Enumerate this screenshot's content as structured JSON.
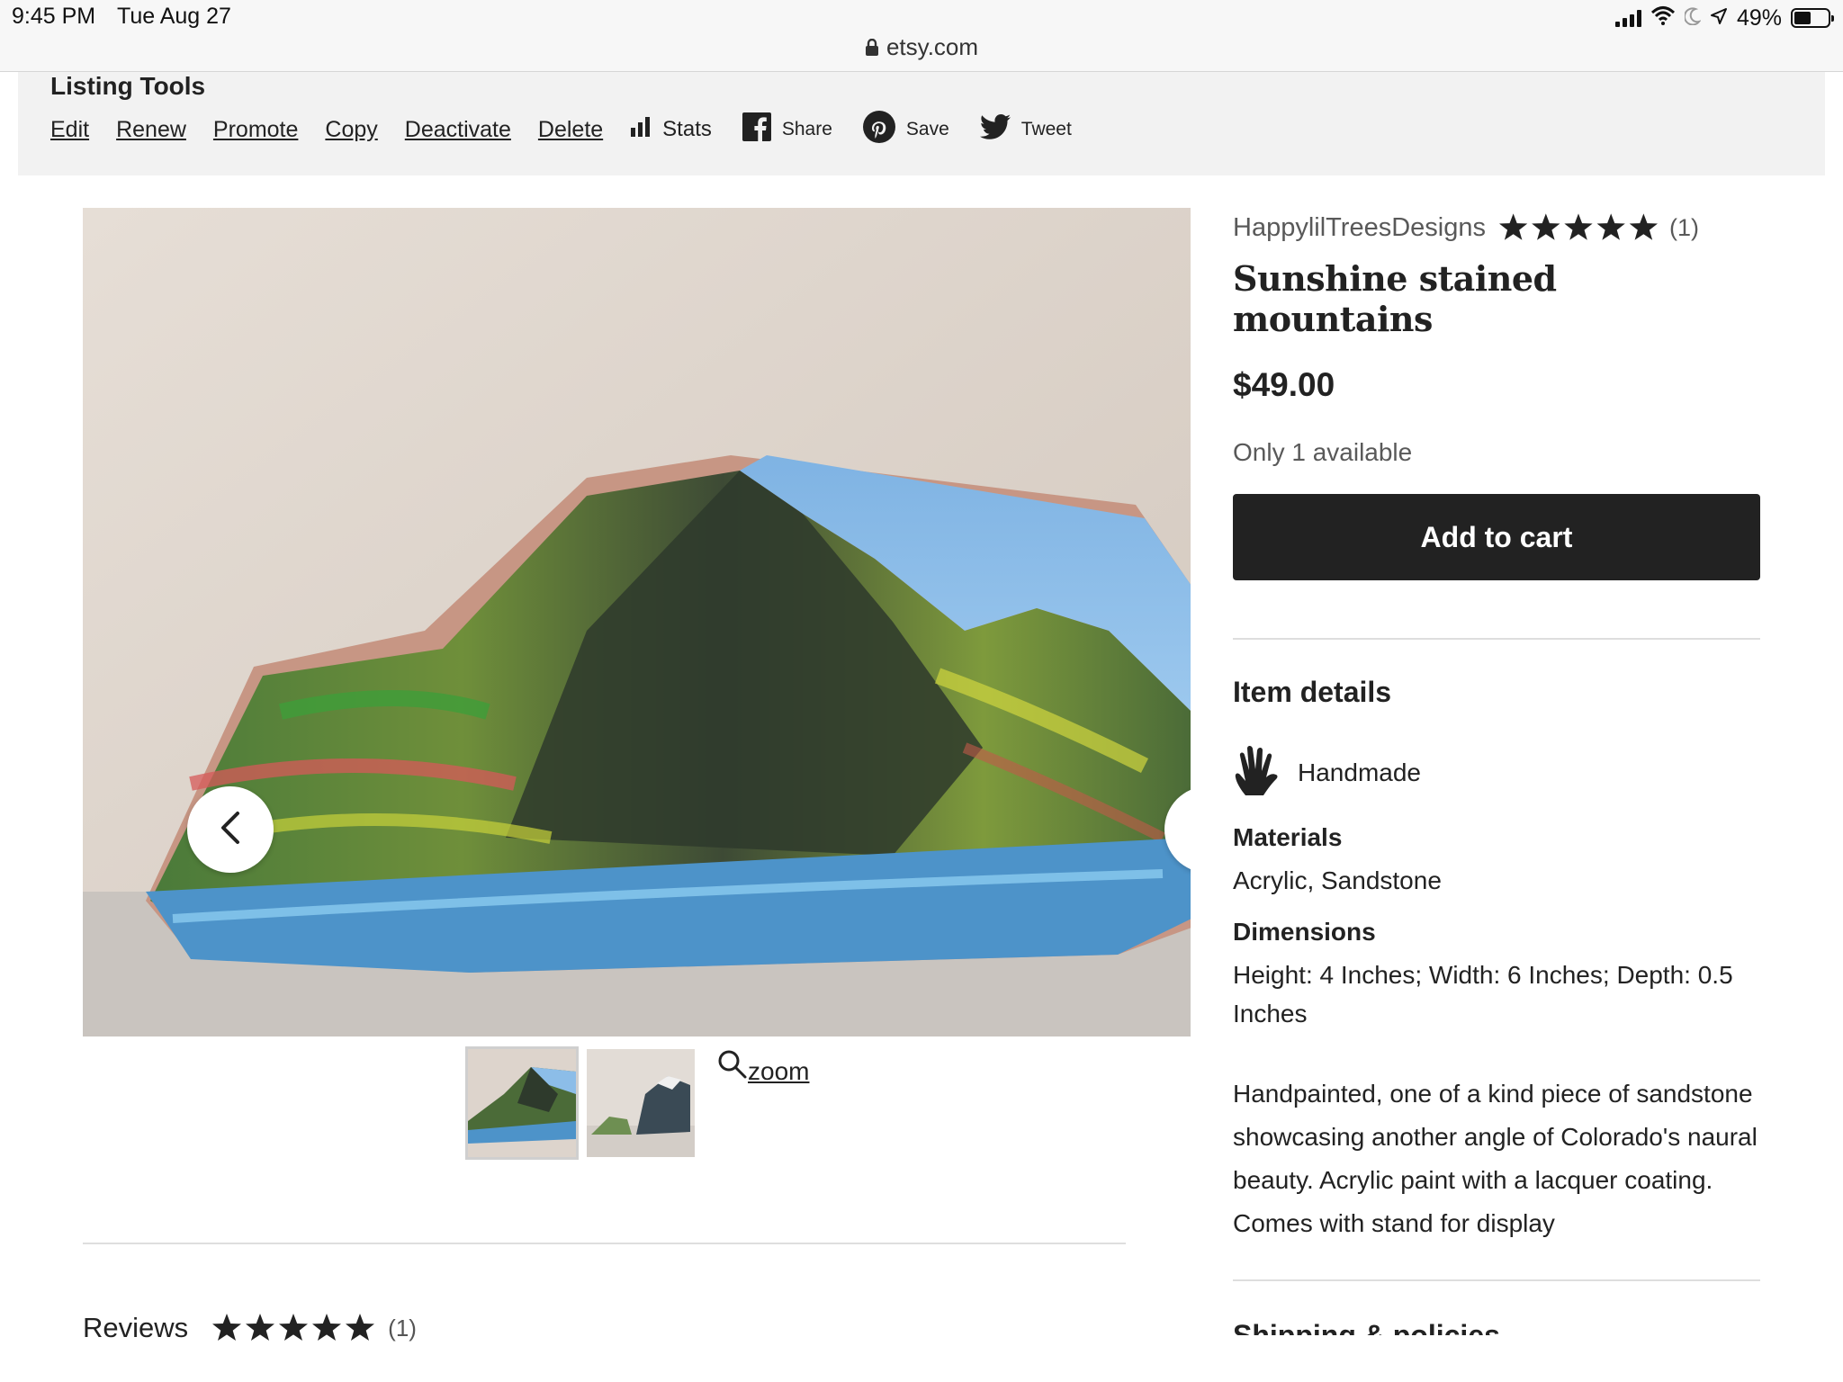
{
  "status_bar": {
    "time": "9:45 PM",
    "date": "Tue Aug 27",
    "url": "etsy.com",
    "battery": "49%",
    "battery_level": 0.49
  },
  "listing_tools": {
    "title": "Listing Tools",
    "links": [
      "Edit",
      "Renew",
      "Promote",
      "Copy",
      "Deactivate",
      "Delete"
    ],
    "stats": "Stats",
    "share": "Share",
    "save": "Save",
    "tweet": "Tweet"
  },
  "gallery": {
    "zoom_label": "zoom",
    "thumbnail_count": 2
  },
  "product": {
    "shop_name": "HappylilTreesDesigns",
    "shop_rating": 5,
    "shop_review_count": "(1)",
    "title": "Sunshine stained mountains",
    "price": "$49.00",
    "availability": "Only 1 available",
    "add_to_cart": "Add to cart"
  },
  "details": {
    "title": "Item details",
    "handmade": "Handmade",
    "materials_label": "Materials",
    "materials_value": "Acrylic, Sandstone",
    "dimensions_label": "Dimensions",
    "dimensions_value": "Height: 4 Inches; Width: 6 Inches; Depth: 0.5 Inches",
    "description": "Handpainted, one of a kind piece of sandstone showcasing another angle of Colorado's naural beauty. Acrylic paint with a lacquer coating. Comes with stand for display",
    "next_section": "Shipping & policies"
  },
  "reviews": {
    "title": "Reviews",
    "rating": 5,
    "count": "(1)"
  },
  "colors": {
    "dark": "#222222",
    "tools_bg": "#f2f2f2",
    "muted_text": "#595959"
  }
}
